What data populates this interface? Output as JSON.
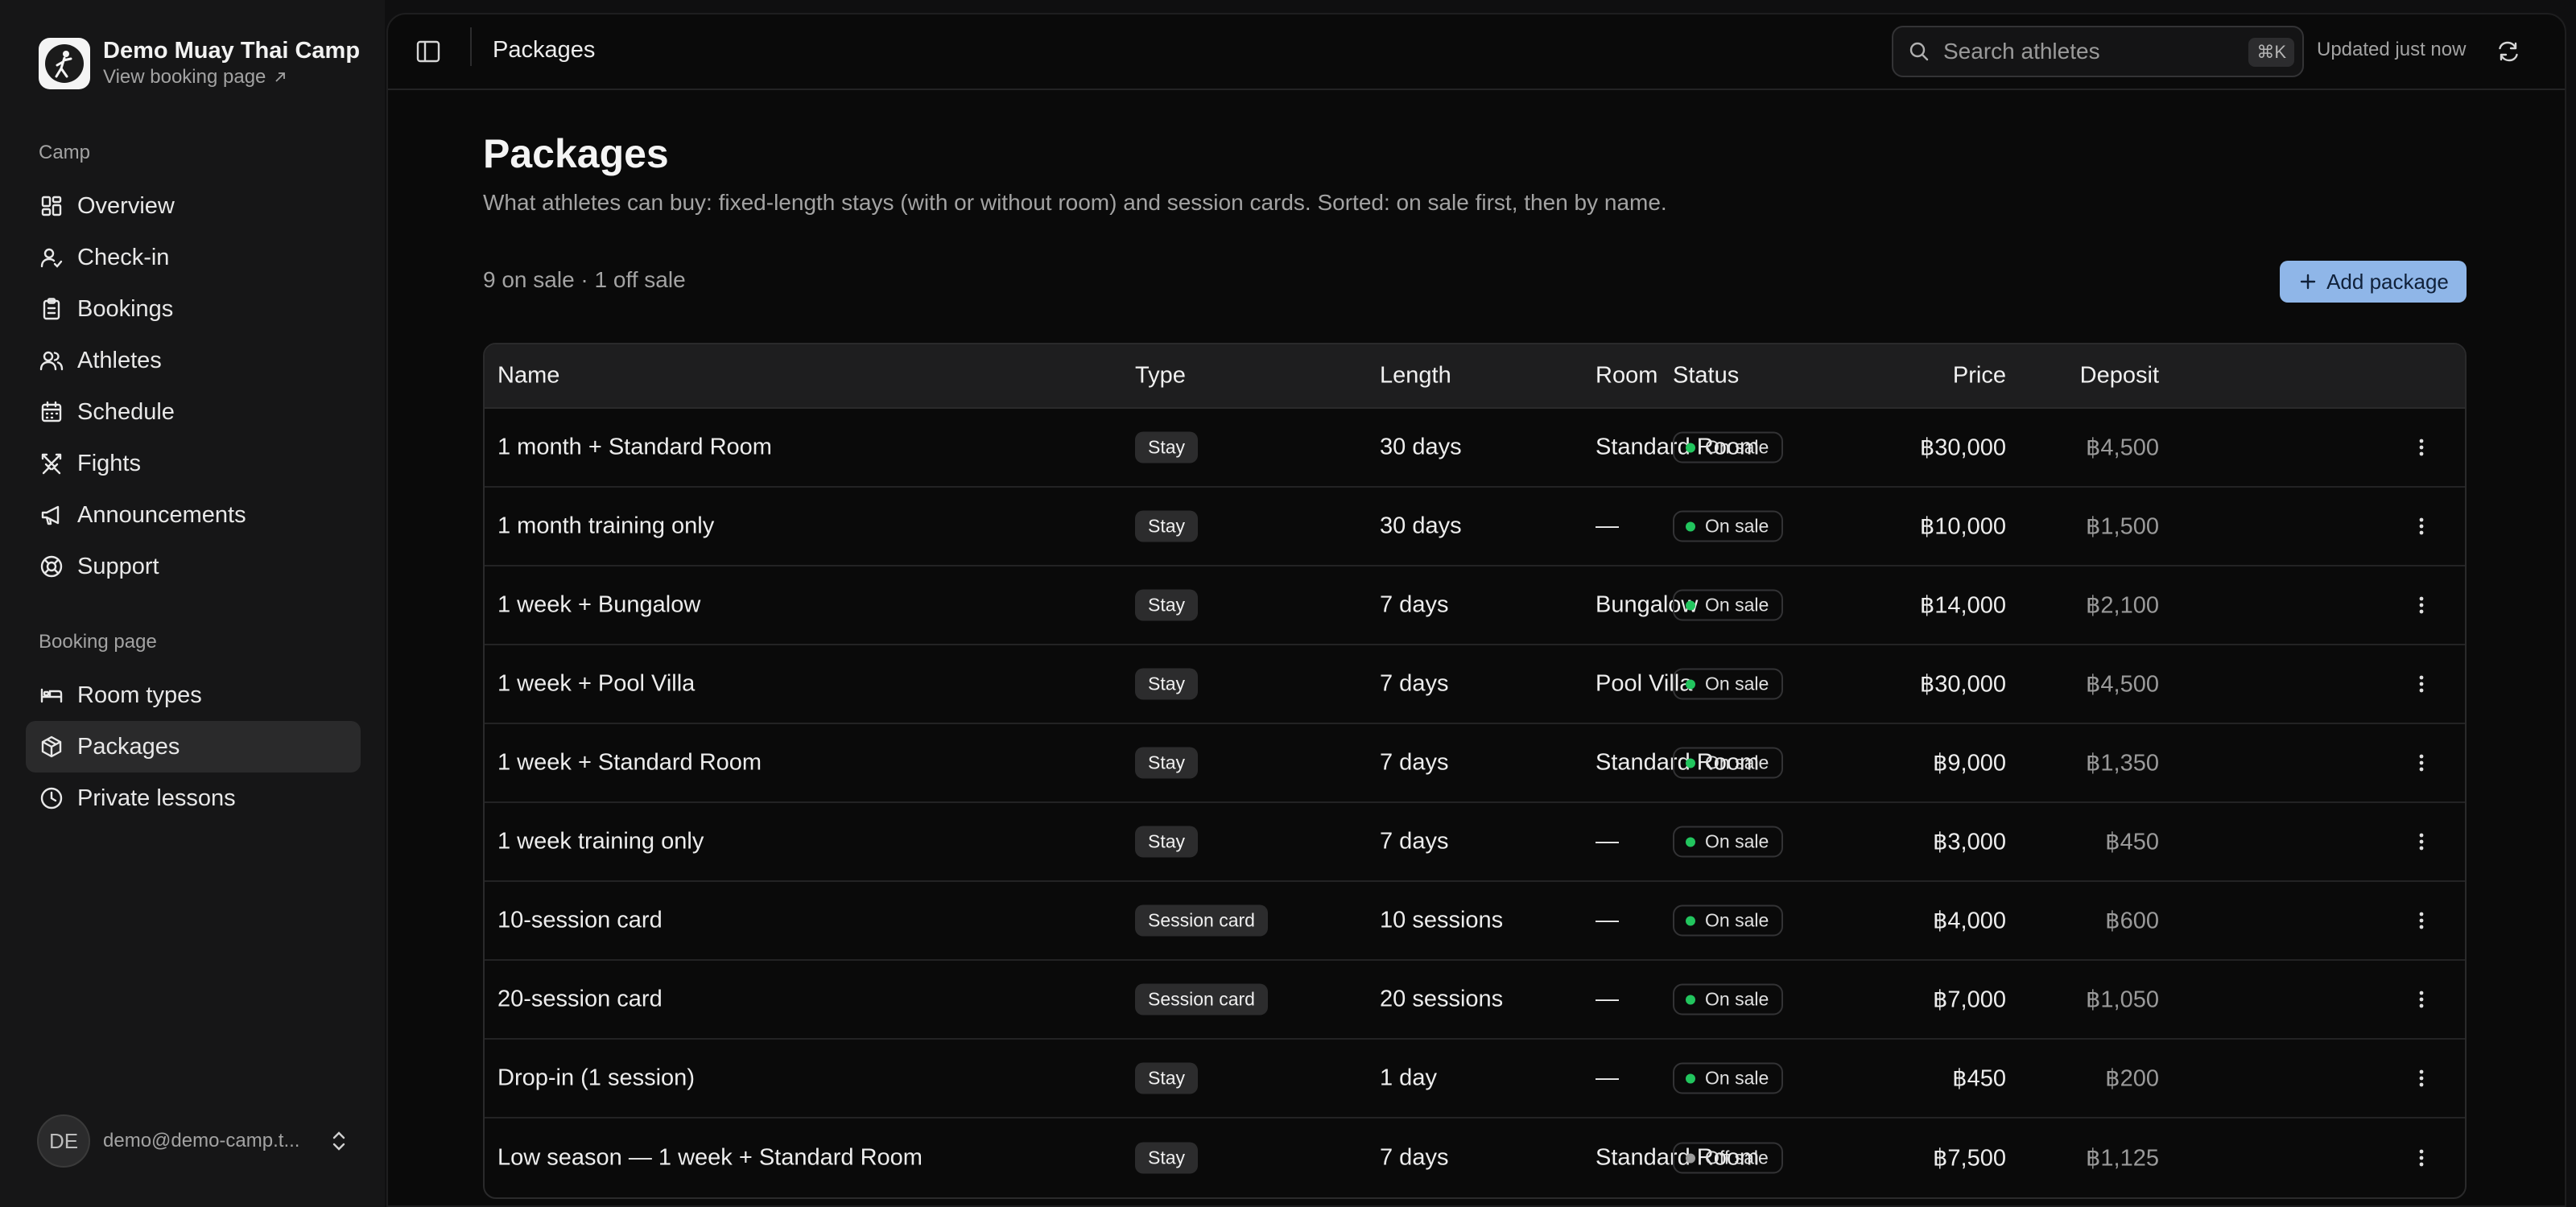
{
  "colors": {
    "accent": "#8fb6e8",
    "on_sale": "#22c55e",
    "off_sale": "#9a9a9a"
  },
  "sidebar": {
    "brand_name": "Demo Muay Thai Camp",
    "brand_link": "View booking page",
    "sections": [
      {
        "title": "Camp",
        "items": [
          {
            "label": "Overview",
            "icon": "dashboard-icon"
          },
          {
            "label": "Check-in",
            "icon": "user-check-icon"
          },
          {
            "label": "Bookings",
            "icon": "clipboard-icon"
          },
          {
            "label": "Athletes",
            "icon": "users-icon"
          },
          {
            "label": "Schedule",
            "icon": "calendar-icon"
          },
          {
            "label": "Fights",
            "icon": "swords-icon"
          },
          {
            "label": "Announcements",
            "icon": "megaphone-icon"
          },
          {
            "label": "Support",
            "icon": "lifebuoy-icon"
          }
        ]
      },
      {
        "title": "Booking page",
        "items": [
          {
            "label": "Room types",
            "icon": "bed-icon"
          },
          {
            "label": "Packages",
            "icon": "package-icon",
            "active": true
          },
          {
            "label": "Private lessons",
            "icon": "clock-icon"
          }
        ]
      }
    ],
    "user": {
      "initials": "DE",
      "email": "demo@demo-camp.t..."
    }
  },
  "topbar": {
    "title": "Packages",
    "search_placeholder": "Search athletes",
    "search_shortcut": "⌘K",
    "updated_text": "Updated just now"
  },
  "page": {
    "title": "Packages",
    "description": "What athletes can buy: fixed-length stays (with or without room) and session cards. Sorted: on sale first, then by name.",
    "counts": "9 on sale · 1 off sale",
    "add_button": "Add package"
  },
  "table": {
    "columns": {
      "name": "Name",
      "type": "Type",
      "length": "Length",
      "room": "Room",
      "price": "Price",
      "deposit": "Deposit",
      "status": "Status"
    },
    "rows": [
      {
        "name": "1 month + Standard Room",
        "type": "Stay",
        "length": "30 days",
        "room": "Standard Room",
        "price": "฿30,000",
        "deposit": "฿4,500",
        "status": "On sale",
        "on_sale": true
      },
      {
        "name": "1 month training only",
        "type": "Stay",
        "length": "30 days",
        "room": "—",
        "price": "฿10,000",
        "deposit": "฿1,500",
        "status": "On sale",
        "on_sale": true
      },
      {
        "name": "1 week + Bungalow",
        "type": "Stay",
        "length": "7 days",
        "room": "Bungalow",
        "price": "฿14,000",
        "deposit": "฿2,100",
        "status": "On sale",
        "on_sale": true
      },
      {
        "name": "1 week + Pool Villa",
        "type": "Stay",
        "length": "7 days",
        "room": "Pool Villa",
        "price": "฿30,000",
        "deposit": "฿4,500",
        "status": "On sale",
        "on_sale": true
      },
      {
        "name": "1 week + Standard Room",
        "type": "Stay",
        "length": "7 days",
        "room": "Standard Room",
        "price": "฿9,000",
        "deposit": "฿1,350",
        "status": "On sale",
        "on_sale": true
      },
      {
        "name": "1 week training only",
        "type": "Stay",
        "length": "7 days",
        "room": "—",
        "price": "฿3,000",
        "deposit": "฿450",
        "status": "On sale",
        "on_sale": true
      },
      {
        "name": "10-session card",
        "type": "Session card",
        "length": "10 sessions",
        "room": "—",
        "price": "฿4,000",
        "deposit": "฿600",
        "status": "On sale",
        "on_sale": true
      },
      {
        "name": "20-session card",
        "type": "Session card",
        "length": "20 sessions",
        "room": "—",
        "price": "฿7,000",
        "deposit": "฿1,050",
        "status": "On sale",
        "on_sale": true
      },
      {
        "name": "Drop-in (1 session)",
        "type": "Stay",
        "length": "1 day",
        "room": "—",
        "price": "฿450",
        "deposit": "฿200",
        "status": "On sale",
        "on_sale": true
      },
      {
        "name": "Low season — 1 week + Standard Room",
        "type": "Stay",
        "length": "7 days",
        "room": "Standard Room",
        "price": "฿7,500",
        "deposit": "฿1,125",
        "status": "Off sale",
        "on_sale": false
      }
    ]
  }
}
